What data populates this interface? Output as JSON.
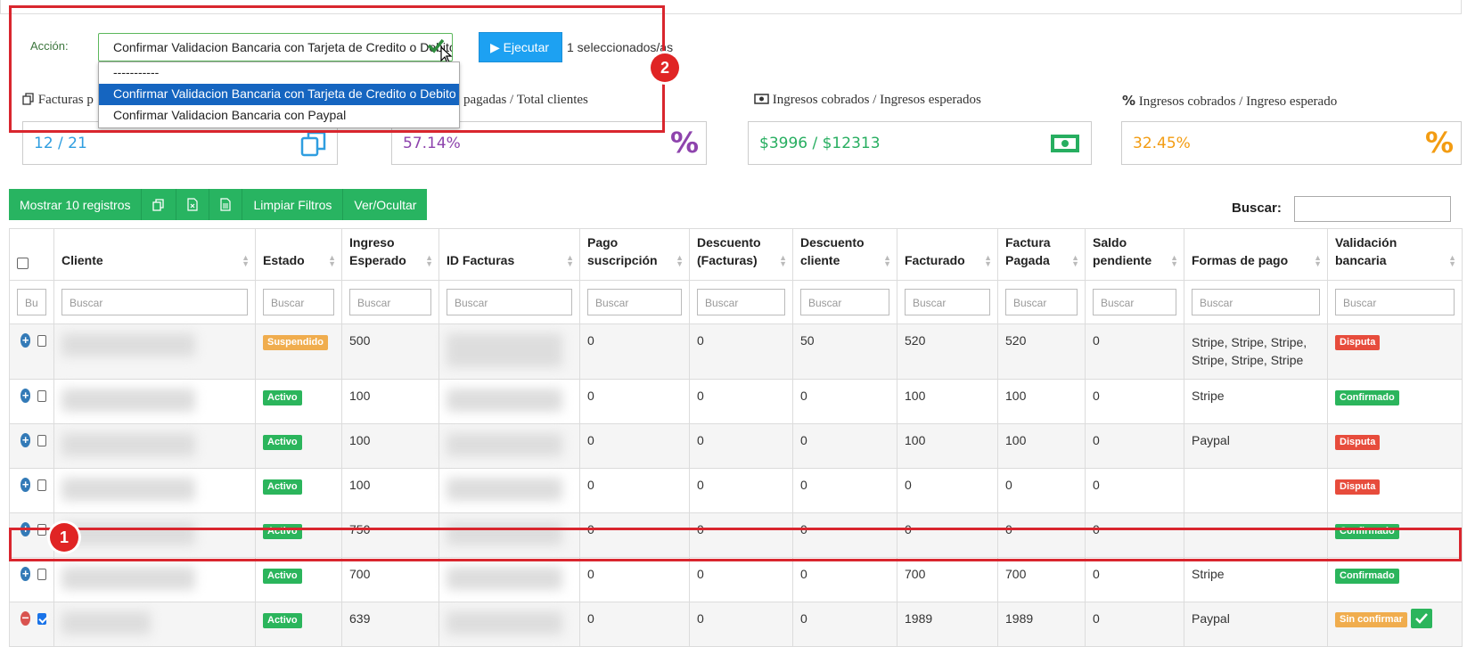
{
  "action": {
    "label": "Acción:",
    "selected": "Confirmar Validacion Bancaria con Tarjeta de Credito o Debito",
    "run_button": "▶ Ejecutar",
    "selected_count": "1 seleccionados/as",
    "options": [
      "-----------",
      "Confirmar Validacion Bancaria con Tarjeta de Credito o Debito",
      "Confirmar Validacion Bancaria con Paypal"
    ]
  },
  "annotations": {
    "one": "1",
    "two": "2"
  },
  "stats": [
    {
      "title": "Facturas p",
      "value": "12 / 21",
      "color": "#2f9ee0",
      "icon": "copy-icon"
    },
    {
      "title": "pagadas / Total clientes",
      "value": "57.14%",
      "color": "#8e44ad",
      "icon": "percent-icon"
    },
    {
      "title": "Ingresos cobrados / Ingresos esperados",
      "value": "$3996 / $12313",
      "color": "#27ae60",
      "icon": "money-icon"
    },
    {
      "title": "Ingresos cobrados / Ingreso esperado",
      "value": "32.45%",
      "color": "#f39c12",
      "icon": "percent-icon"
    }
  ],
  "toolbar": {
    "show": "Mostrar 10 registros",
    "clear": "Limpiar Filtros",
    "toggle": "Ver/Ocultar",
    "search_label": "Buscar:"
  },
  "table": {
    "headers": {
      "cliente": "Cliente",
      "estado": "Estado",
      "ingreso_1": "Ingreso",
      "ingreso_2": "Esperado",
      "id_facturas": "ID Facturas",
      "pago_1": "Pago",
      "pago_2": "suscripción",
      "descf_1": "Descuento",
      "descf_2": "(Facturas)",
      "descc_1": "Descuento",
      "descc_2": "cliente",
      "facturado": "Facturado",
      "fp_1": "Factura",
      "fp_2": "Pagada",
      "saldo_1": "Saldo",
      "saldo_2": "pendiente",
      "formas": "Formas de pago",
      "vb_1": "Validación",
      "vb_2": "bancaria"
    },
    "filter_placeholder": "Buscar",
    "filter_placeholder_short": "Bu",
    "rows": [
      {
        "estado": "Suspendido",
        "ingreso": "500",
        "pago": "0",
        "desc_f": "0",
        "desc_c": "50",
        "facturado": "520",
        "pagada": "520",
        "saldo": "0",
        "formas": "Stripe, Stripe, Stripe, Stripe, Stripe, Stripe",
        "validacion": "Disputa"
      },
      {
        "estado": "Activo",
        "ingreso": "100",
        "pago": "0",
        "desc_f": "0",
        "desc_c": "0",
        "facturado": "100",
        "pagada": "100",
        "saldo": "0",
        "formas": "Stripe",
        "validacion": "Confirmado"
      },
      {
        "estado": "Activo",
        "ingreso": "100",
        "pago": "0",
        "desc_f": "0",
        "desc_c": "0",
        "facturado": "100",
        "pagada": "100",
        "saldo": "0",
        "formas": "Paypal",
        "validacion": "Disputa"
      },
      {
        "estado": "Activo",
        "ingreso": "100",
        "pago": "0",
        "desc_f": "0",
        "desc_c": "0",
        "facturado": "0",
        "pagada": "0",
        "saldo": "0",
        "formas": "",
        "validacion": "Disputa"
      },
      {
        "estado": "Activo",
        "ingreso": "750",
        "pago": "0",
        "desc_f": "0",
        "desc_c": "0",
        "facturado": "0",
        "pagada": "0",
        "saldo": "0",
        "formas": "",
        "validacion": "Confirmado"
      },
      {
        "estado": "Activo",
        "ingreso": "700",
        "pago": "0",
        "desc_f": "0",
        "desc_c": "0",
        "facturado": "700",
        "pagada": "700",
        "saldo": "0",
        "formas": "Stripe",
        "validacion": "Confirmado"
      },
      {
        "estado": "Activo",
        "ingreso": "639",
        "pago": "0",
        "desc_f": "0",
        "desc_c": "0",
        "facturado": "1989",
        "pagada": "1989",
        "saldo": "0",
        "formas": "Paypal",
        "validacion": "Sin confirmar"
      }
    ]
  },
  "colors": {
    "primary": "#1da1f2",
    "toolbar_green": "#28b461",
    "annotation_red": "#d9262e",
    "label_warning": "#f0ad4e",
    "label_success": "#2bb55c",
    "label_danger": "#e74c3c"
  }
}
